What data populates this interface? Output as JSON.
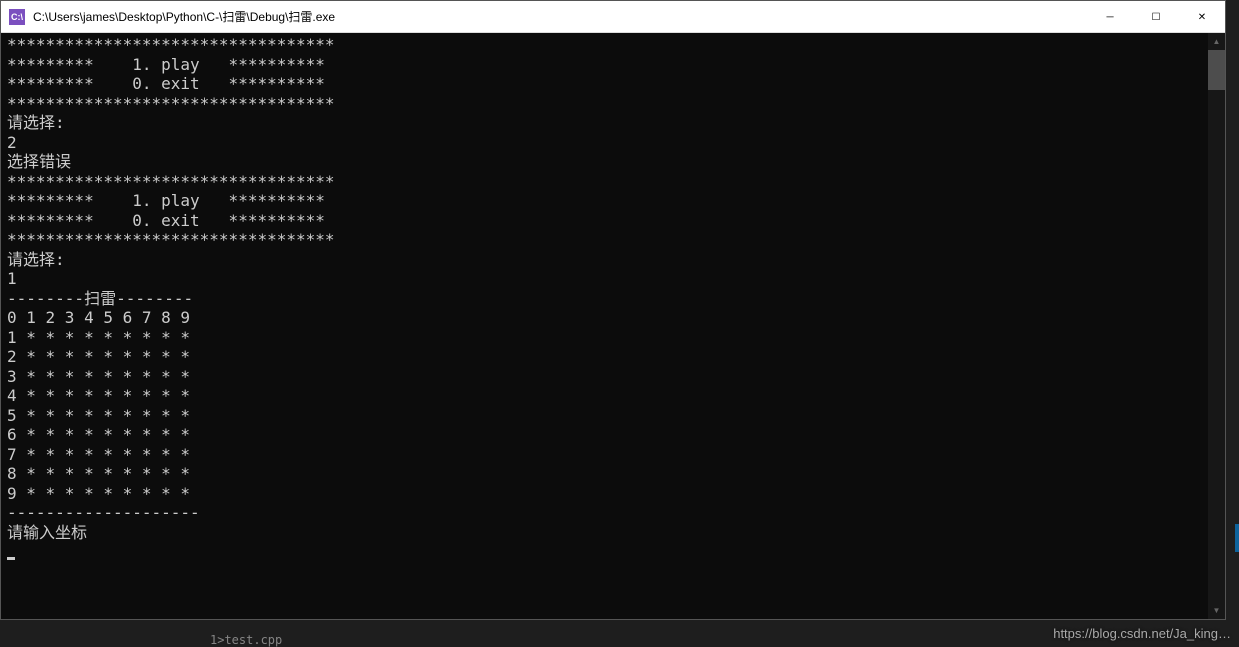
{
  "window": {
    "icon_text": "C:\\",
    "title": "C:\\Users\\james\\Desktop\\Python\\C-\\扫雷\\Debug\\扫雷.exe"
  },
  "titlebar_buttons": {
    "minimize": "─",
    "maximize": "☐",
    "close": "✕"
  },
  "console": {
    "lines": [
      "**********************************",
      "*********    1. play   **********",
      "*********    0. exit   **********",
      "**********************************",
      "请选择:",
      "2",
      "选择错误",
      "**********************************",
      "*********    1. play   **********",
      "*********    0. exit   **********",
      "**********************************",
      "请选择:",
      "1",
      "--------扫雷--------",
      "0 1 2 3 4 5 6 7 8 9",
      "1 * * * * * * * * *",
      "2 * * * * * * * * *",
      "3 * * * * * * * * *",
      "4 * * * * * * * * *",
      "5 * * * * * * * * *",
      "6 * * * * * * * * *",
      "7 * * * * * * * * *",
      "8 * * * * * * * * *",
      "9 * * * * * * * * *",
      "--------------------",
      "请输入坐标"
    ]
  },
  "background": {
    "tab_text": "1>test.cpp"
  },
  "watermark": "https://blog.csdn.net/Ja_king…"
}
